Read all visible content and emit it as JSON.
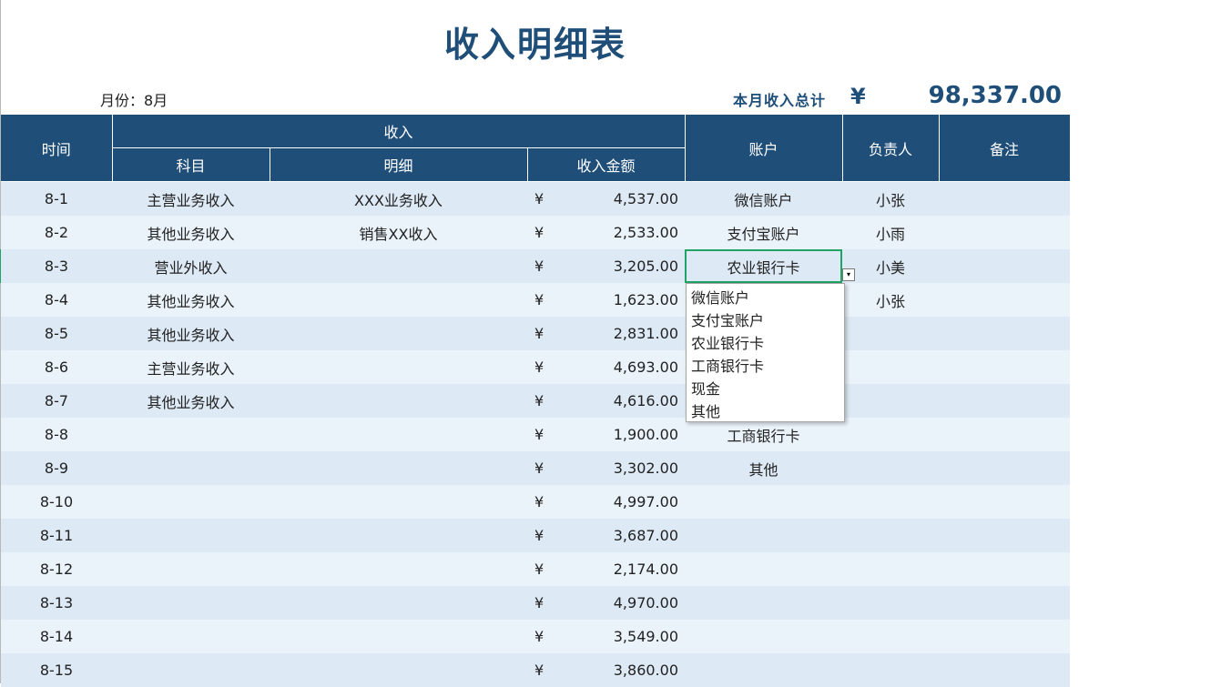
{
  "title": "收入明细表",
  "month_label": "月份：8月",
  "total_label": "本月收入总计",
  "total_currency": "¥",
  "total_value": "98,337.00",
  "headers": {
    "time": "时间",
    "income": "收入",
    "subject": "科目",
    "detail": "明细",
    "amount": "收入金额",
    "account": "账户",
    "owner": "负责人",
    "note": "备注"
  },
  "currency_symbol": "¥",
  "rows": [
    {
      "time": "8-1",
      "subject": "主营业务收入",
      "detail": "XXX业务收入",
      "amount": "4,537.00",
      "account": "微信账户",
      "owner": "小张",
      "note": ""
    },
    {
      "time": "8-2",
      "subject": "其他业务收入",
      "detail": "销售XX收入",
      "amount": "2,533.00",
      "account": "支付宝账户",
      "owner": "小雨",
      "note": ""
    },
    {
      "time": "8-3",
      "subject": "营业外收入",
      "detail": "",
      "amount": "3,205.00",
      "account": "农业银行卡",
      "owner": "小美",
      "note": ""
    },
    {
      "time": "8-4",
      "subject": "其他业务收入",
      "detail": "",
      "amount": "1,623.00",
      "account": "",
      "owner": "小张",
      "note": ""
    },
    {
      "time": "8-5",
      "subject": "其他业务收入",
      "detail": "",
      "amount": "2,831.00",
      "account": "",
      "owner": "",
      "note": ""
    },
    {
      "time": "8-6",
      "subject": "主营业务收入",
      "detail": "",
      "amount": "4,693.00",
      "account": "",
      "owner": "",
      "note": ""
    },
    {
      "time": "8-7",
      "subject": "其他业务收入",
      "detail": "",
      "amount": "4,616.00",
      "account": "",
      "owner": "",
      "note": ""
    },
    {
      "time": "8-8",
      "subject": "",
      "detail": "",
      "amount": "1,900.00",
      "account": "工商银行卡",
      "owner": "",
      "note": ""
    },
    {
      "time": "8-9",
      "subject": "",
      "detail": "",
      "amount": "3,302.00",
      "account": "其他",
      "owner": "",
      "note": ""
    },
    {
      "time": "8-10",
      "subject": "",
      "detail": "",
      "amount": "4,997.00",
      "account": "",
      "owner": "",
      "note": ""
    },
    {
      "time": "8-11",
      "subject": "",
      "detail": "",
      "amount": "3,687.00",
      "account": "",
      "owner": "",
      "note": ""
    },
    {
      "time": "8-12",
      "subject": "",
      "detail": "",
      "amount": "2,174.00",
      "account": "",
      "owner": "",
      "note": ""
    },
    {
      "time": "8-13",
      "subject": "",
      "detail": "",
      "amount": "4,970.00",
      "account": "",
      "owner": "",
      "note": ""
    },
    {
      "time": "8-14",
      "subject": "",
      "detail": "",
      "amount": "3,549.00",
      "account": "",
      "owner": "",
      "note": ""
    },
    {
      "time": "8-15",
      "subject": "",
      "detail": "",
      "amount": "3,860.00",
      "account": "",
      "owner": "",
      "note": ""
    }
  ],
  "selected_row_index": 2,
  "dropdown": {
    "arrow_icon": "▾",
    "options": [
      "微信账户",
      "支付宝账户",
      "农业银行卡",
      "工商银行卡",
      "现金",
      "其他"
    ]
  },
  "colors": {
    "header_bg": "#1f4e79",
    "row_odd": "#dde9f5",
    "row_even": "#eaf2fa",
    "selection": "#21a366"
  }
}
